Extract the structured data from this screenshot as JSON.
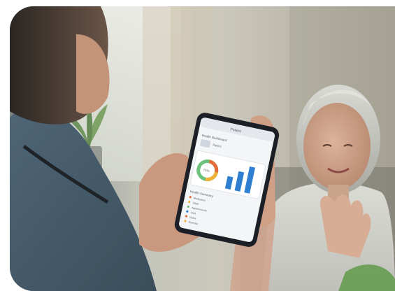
{
  "photo": {
    "subject": "photo-scene"
  },
  "tablet": {
    "app_title": "Patient",
    "header_chip": "...",
    "card_title": "Health Dashboard",
    "patient_name": "Patient",
    "patient_sub": "...",
    "donut_value": "75%",
    "list_title": "Health Summary",
    "list_items": [
      "Medication",
      "Vitals",
      "Appointments",
      "Labs",
      "Notes",
      "Exercise"
    ],
    "accent": "#2f7fd0",
    "donut_colors": [
      "#e36b3a",
      "#f0b13a",
      "#6cc27a",
      "#2f7fd0"
    ]
  },
  "chart_data": {
    "type": "bar",
    "categories": [
      "",
      "",
      ""
    ],
    "values": [
      0.45,
      0.7,
      0.95
    ]
  }
}
